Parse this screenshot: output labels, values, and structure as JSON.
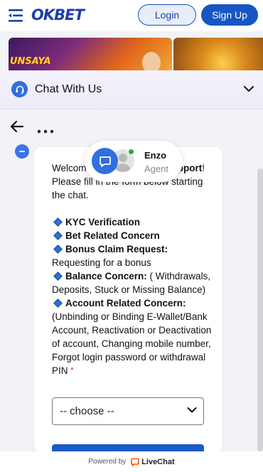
{
  "site": {
    "logo_text": "OKBET",
    "login_label": "Login",
    "signup_label": "Sign Up",
    "banner_promo_text": "UNSAYA",
    "colors": {
      "brand": "#1656c2",
      "accent": "#2f6fe0"
    }
  },
  "chat": {
    "title": "Chat With Us",
    "icons": {
      "header": "headset-icon",
      "collapse": "chevron-down-icon",
      "back": "arrow-left-icon",
      "more": "more-horizontal-icon"
    }
  },
  "agent": {
    "name": "Enzo",
    "role": "Agent",
    "online": true
  },
  "message": {
    "intro_part1": "Welcome to ",
    "intro_bold": "OKBET Chat Support",
    "intro_part2": "! Please fill in the form below starting the chat.",
    "items": [
      {
        "label": "KYC Verification",
        "detail": ""
      },
      {
        "label": "Bet Related Concern",
        "detail": ""
      },
      {
        "label": "Bonus Claim Request:",
        "detail": " Requesting for a bonus"
      },
      {
        "label": "Balance Concern:",
        "detail": " ( Withdrawals, Deposits, Stuck or Missing Balance)"
      },
      {
        "label": "Account Related Concern:",
        "detail": " (Unbinding or Binding E-Wallet/Bank Account, Reactivation or Deactivation of account, Changing mobile number, Forgot login password or withdrawal PIN"
      }
    ],
    "required_mark": "*",
    "select_value": "-- choose --"
  },
  "footer": {
    "powered_by": "Powered by",
    "brand": "LiveChat"
  }
}
